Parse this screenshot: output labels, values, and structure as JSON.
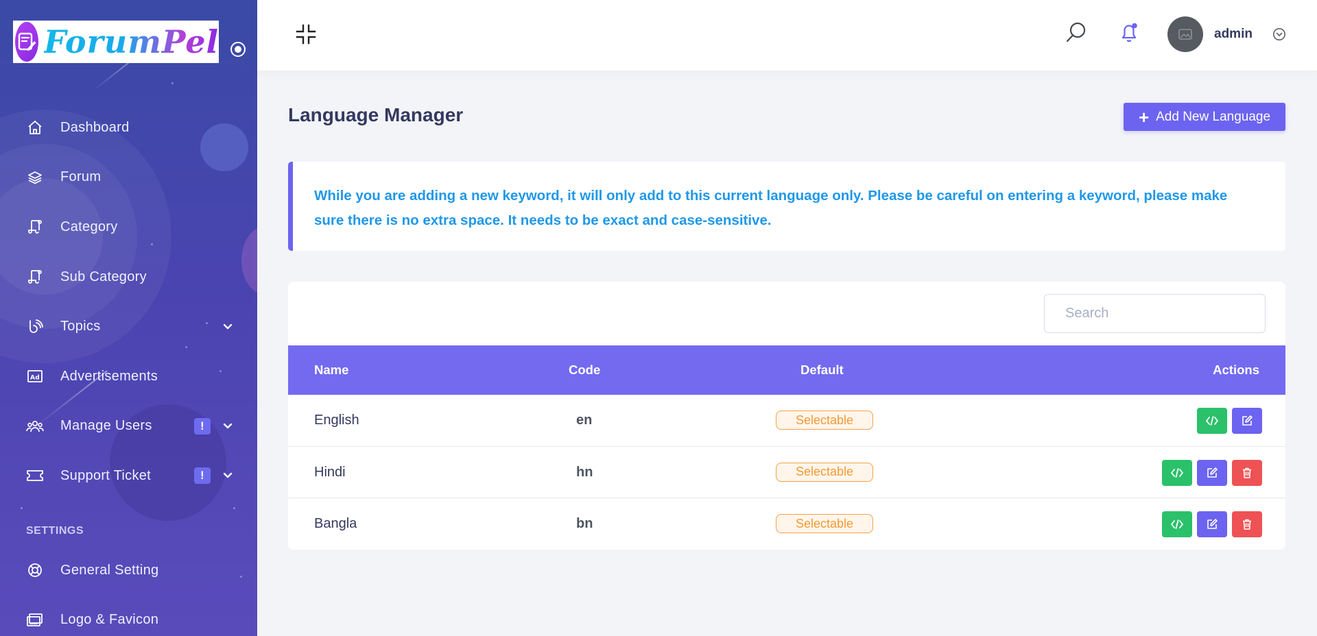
{
  "brand": {
    "name": "ForumPel"
  },
  "sidebar": {
    "items": [
      {
        "label": "Dashboard",
        "icon": "home-icon"
      },
      {
        "label": "Forum",
        "icon": "layers-icon"
      },
      {
        "label": "Category",
        "icon": "scroll-icon"
      },
      {
        "label": "Sub Category",
        "icon": "scroll-icon"
      },
      {
        "label": "Topics",
        "icon": "topics-icon",
        "has_submenu": true
      },
      {
        "label": "Advertisements",
        "icon": "ad-icon"
      },
      {
        "label": "Manage Users",
        "icon": "users-icon",
        "badge": "!",
        "has_submenu": true
      },
      {
        "label": "Support Ticket",
        "icon": "ticket-icon",
        "badge": "!",
        "has_submenu": true
      }
    ],
    "section_label": "SETTINGS",
    "settings_items": [
      {
        "label": "General Setting",
        "icon": "lifebuoy-icon"
      },
      {
        "label": "Logo & Favicon",
        "icon": "monitor-icon"
      }
    ]
  },
  "header": {
    "user_name": "admin"
  },
  "page": {
    "title": "Language Manager",
    "add_button_label": "Add New Language",
    "alert_text": "While you are adding a new keyword, it will only add to this current language only. Please be careful on entering a keyword, please make sure there is no extra space. It needs to be exact and case-sensitive."
  },
  "table": {
    "search_placeholder": "Search",
    "columns": {
      "name": "Name",
      "code": "Code",
      "default": "Default",
      "actions": "Actions"
    },
    "rows": [
      {
        "name": "English",
        "code": "en",
        "default": "Selectable",
        "deletable": false
      },
      {
        "name": "Hindi",
        "code": "hn",
        "default": "Selectable",
        "deletable": true
      },
      {
        "name": "Bangla",
        "code": "bn",
        "default": "Selectable",
        "deletable": true
      }
    ]
  },
  "colors": {
    "primary": "#6c63f0",
    "table_header": "#736af0",
    "alert_text": "#2098e8",
    "success": "#2ac16a",
    "danger": "#ee5255",
    "warning": "#f39a35"
  }
}
